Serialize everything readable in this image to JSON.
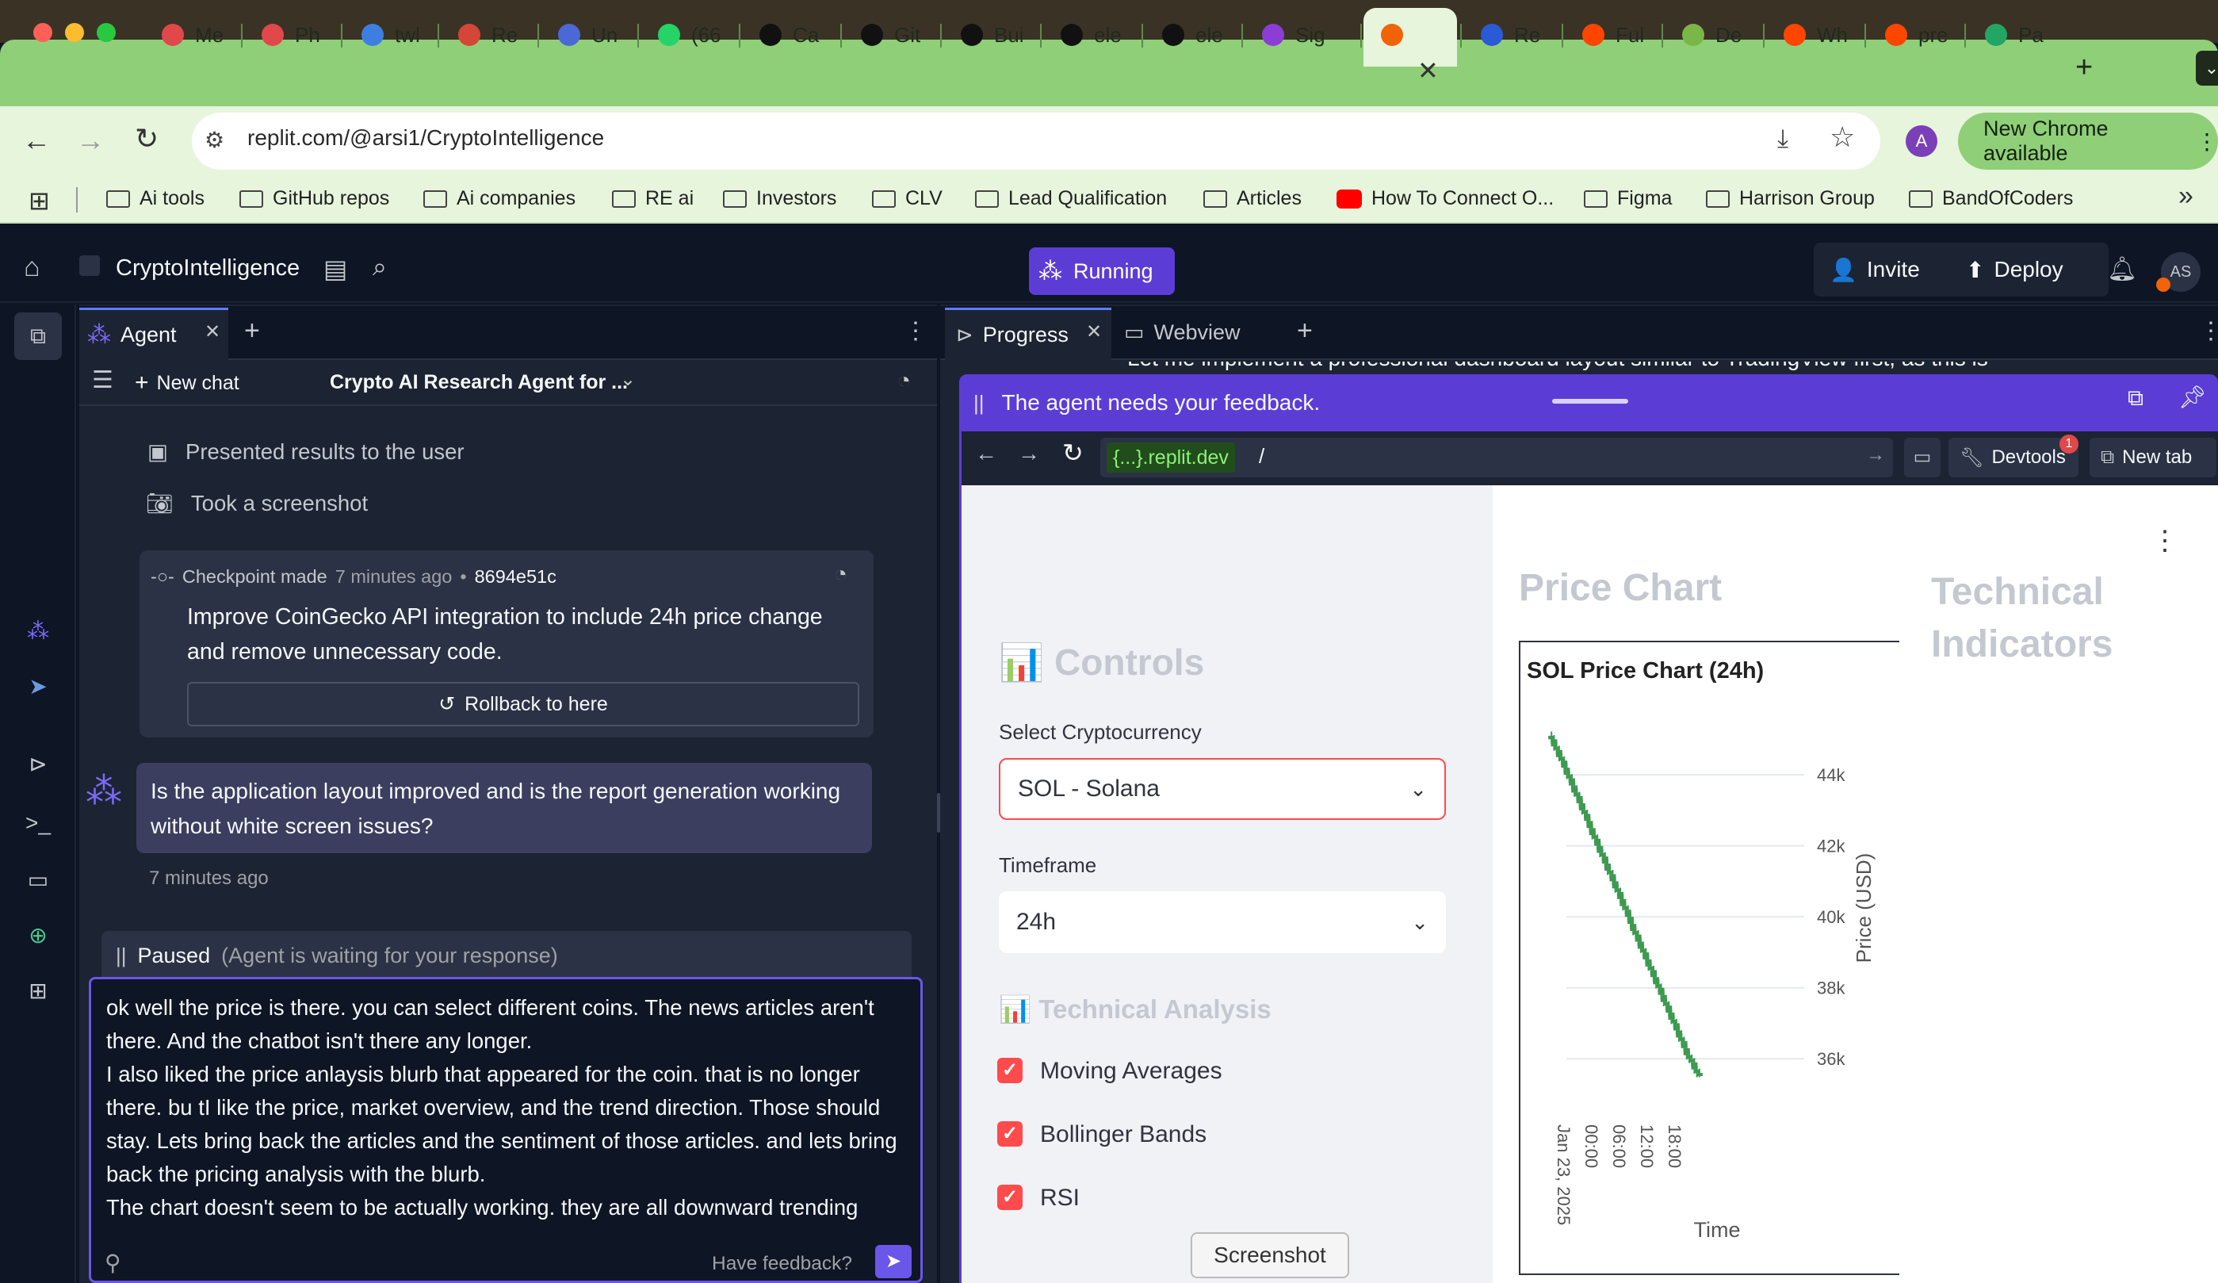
{
  "browser": {
    "tabs": [
      {
        "label": "Me",
        "color": "#e0484a"
      },
      {
        "label": "Ph",
        "color": "#e0484a"
      },
      {
        "label": "twl",
        "color": "#3d7fe0"
      },
      {
        "label": "Re",
        "color": "#d44638"
      },
      {
        "label": "Un",
        "color": "#4a68d6"
      },
      {
        "label": "(66",
        "color": "#25d366"
      },
      {
        "label": "Ca",
        "color": "#111111"
      },
      {
        "label": "Git",
        "color": "#111111"
      },
      {
        "label": "Bui",
        "color": "#111111"
      },
      {
        "label": "ele",
        "color": "#111111"
      },
      {
        "label": "ele",
        "color": "#111111"
      },
      {
        "label": "Sig",
        "color": "#8b3dd6"
      },
      {
        "label": "",
        "color": "#f26207"
      },
      {
        "label": "Re",
        "color": "#2a5ad6"
      },
      {
        "label": "Ful",
        "color": "#ff4500"
      },
      {
        "label": "De",
        "color": "#7ab648"
      },
      {
        "label": "Wh",
        "color": "#ff4500"
      },
      {
        "label": "pre",
        "color": "#ff4500"
      },
      {
        "label": "Pa",
        "color": "#23a566"
      }
    ],
    "url": "replit.com/@arsi1/CryptoIntelligence",
    "new_chrome": "New Chrome available",
    "profile_initial": "A",
    "bookmarks": [
      "Ai tools",
      "GitHub repos",
      "Ai companies",
      "RE ai",
      "Investors",
      "CLV",
      "Lead Qualification",
      "Articles",
      "How To Connect O...",
      "Figma",
      "Harrison Group",
      "BandOfCoders"
    ]
  },
  "replit": {
    "project_name": "CryptoIntelligence",
    "run_status": "Running",
    "invite": "Invite",
    "deploy": "Deploy",
    "avatar": "AS"
  },
  "agent": {
    "tab_label": "Agent",
    "new_chat": "New chat",
    "chat_title": "Crypto AI Research Agent for ...",
    "actions": [
      "Presented results to the user",
      "Took a screenshot"
    ],
    "checkpoint": {
      "label": "Checkpoint made",
      "time": "7 minutes ago",
      "hash": "8694e51c",
      "message": "Improve CoinGecko API integration to include 24h price change and remove unnecessary code.",
      "rollback": "Rollback to here"
    },
    "user_message": "Is the application layout improved and is the report generation working without white screen issues?",
    "user_message_time": "7 minutes ago",
    "paused_label": "Paused",
    "paused_note": "(Agent is waiting for your response)",
    "compose_text": "ok well the price is there. you can select different coins. The news articles aren't there. And the chatbot isn't there any longer.\nI also liked the price anlaysis blurb that appeared for the coin. that is no longer there. bu tI like the price, market overview, and the trend direction. Those should stay. Lets bring back the articles and the sentiment of those articles. and lets bring back the pricing analysis with the blurb.\nThe chart doesn't seem to be actually working. they are all downward trending",
    "feedback_link": "Have feedback?"
  },
  "workspace": {
    "tabs": [
      "Progress",
      "Webview"
    ],
    "behind_text": "Let me implement a professional dashboard layout similar to TradingView first, as this is",
    "feedback_banner": "The agent needs your feedback.",
    "domain": "{...}.replit.dev",
    "path": "/",
    "devtools": "Devtools",
    "devtools_badge": "1",
    "new_tab": "New tab"
  },
  "app": {
    "controls_title": "📊 Controls",
    "select_label": "Select Cryptocurrency",
    "select_value": "SOL - Solana",
    "timeframe_label": "Timeframe",
    "timeframe_value": "24h",
    "ta_title": "📊 Technical Analysis",
    "checkboxes": [
      "Moving Averages",
      "Bollinger Bands",
      "RSI"
    ],
    "price_chart_heading": "Price Chart",
    "indicators_heading": "Technical Indicators",
    "screenshot_tooltip": "Screenshot"
  },
  "chart_data": {
    "type": "candlestick",
    "title": "SOL Price Chart (24h)",
    "xlabel": "Time",
    "ylabel": "Price (USD)",
    "y_ticks": [
      "44k",
      "42k",
      "40k",
      "38k",
      "36k"
    ],
    "y_tick_values": [
      44000,
      42000,
      40000,
      38000,
      36000
    ],
    "ylim": [
      35000,
      45500
    ],
    "x_ticks": [
      "Jan 23, 2025",
      "00:00",
      "06:00",
      "12:00",
      "18:00"
    ],
    "x_tick_hours": [
      0,
      3,
      6,
      9,
      12
    ],
    "xlim": [
      0,
      24
    ],
    "candle_color": "#3d9a50",
    "series": [
      {
        "values": [
          45100,
          45000,
          44800,
          44700,
          44500,
          44400,
          44200,
          44000,
          43900,
          43700,
          43500,
          43400,
          43200,
          43000,
          42900,
          42700,
          42500,
          42300,
          42200,
          42000,
          41800,
          41700,
          41500,
          41300,
          41200,
          41000,
          40800,
          40700,
          40500,
          40300,
          40200,
          40000,
          39800,
          39600,
          39500,
          39300,
          39100,
          39000,
          38800,
          38600,
          38500,
          38300,
          38100,
          38000,
          37800,
          37600,
          37500,
          37300,
          37100,
          37000,
          36800,
          36600,
          36500,
          36300,
          36100,
          36000,
          35900,
          35700,
          35600
        ]
      }
    ]
  }
}
